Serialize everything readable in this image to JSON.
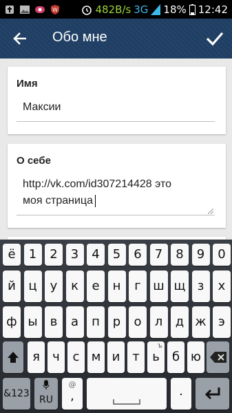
{
  "status_bar": {
    "net_speed": "482B/s",
    "network": "3G",
    "battery": "18%",
    "time": "12:42"
  },
  "app_bar": {
    "title": "Обо мне",
    "back_icon": "arrow-left-icon",
    "confirm_icon": "check-icon"
  },
  "name_field": {
    "label": "Имя",
    "value": "Максии"
  },
  "about_field": {
    "label": "О себе",
    "line1": "http://vk.com/id307214428 это",
    "line2": "моя страница"
  },
  "keyboard": {
    "row1": [
      "ё",
      "1",
      "2",
      "3",
      "4",
      "5",
      "6",
      "7",
      "8",
      "9",
      "0"
    ],
    "row2": [
      "й",
      "ц",
      "у",
      "к",
      "е",
      "н",
      "г",
      "ш",
      "щ",
      "з",
      "х"
    ],
    "row3": [
      "ф",
      "ы",
      "в",
      "а",
      "п",
      "р",
      "о",
      "л",
      "д",
      "ж",
      "э"
    ],
    "row4": [
      "я",
      "ч",
      "с",
      "м",
      "и",
      "т",
      "ь",
      "б",
      "ю"
    ],
    "row4_alt": "ъ",
    "symbols_label": "&123",
    "lang_label": "RU",
    "at_label": "@",
    "comma_label": ","
  },
  "colors": {
    "app_bar": "#1f3e63",
    "background": "#e9e9e9",
    "keyboard_bg": "#2e3238"
  }
}
